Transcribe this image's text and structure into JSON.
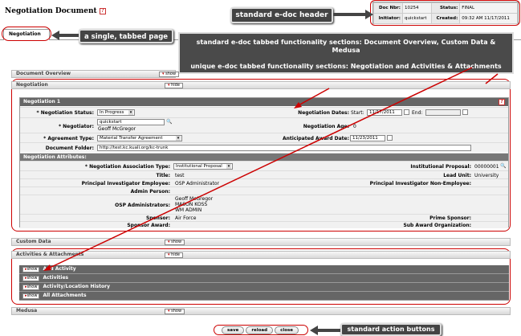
{
  "doc": {
    "title": "Negotiation Document"
  },
  "header": {
    "doc_nbr_label": "Doc Nbr:",
    "doc_nbr": "10254",
    "status_label": "Status:",
    "status": "FINAL",
    "initiator_label": "Initiator:",
    "initiator": "quickstart",
    "created_label": "Created:",
    "created": "09:32 AM 11/17/2011"
  },
  "tab": {
    "label": "Negotiation"
  },
  "callouts": {
    "header": "standard e-doc header",
    "tabbed": "a single, tabbed page",
    "sections_line1": "standard e-doc tabbed functionality sections:  Document Overview, Custom Data & Medusa",
    "sections_line2": "unique e-doc tabbed functionality sections:  Negotiation and Activities & Attachments",
    "actions": "standard action buttons"
  },
  "sections": {
    "overview": "Document Overview",
    "negotiation": "Negotiation",
    "custom": "Custom Data",
    "activities": "Activities & Attachments",
    "medusa": "Medusa",
    "show": "show",
    "hide": "hide"
  },
  "neg": {
    "panel_title": "Negotiation 1",
    "status_label": "* Negotiation Status:",
    "status": "In Progress",
    "dates_label": "Negotiation Dates:",
    "start_label": "Start:",
    "start": "11/17/2011",
    "end_label": "End:",
    "negotiator_label": "* Negotiator:",
    "negotiator_id": "quickstart",
    "negotiator_name": "Geoff McGregor",
    "age_label": "Negotiation Age:",
    "age": "0",
    "agreement_label": "* Agreement Type:",
    "agreement": "Material Transfer Agreement",
    "anticipated_label": "Anticipated Award Date:",
    "anticipated": "11/23/2011",
    "folder_label": "Document Folder:",
    "folder": "http://test.kc.kuali.org/kc-trunk"
  },
  "attrs": {
    "title": "Negotiation Attributes:",
    "assoc_label": "* Negotiation Association Type:",
    "assoc": "Institutional Proposal",
    "ip_label": "Institutional Proposal:",
    "ip": "00000001",
    "title_label": "Title:",
    "title_val": "test",
    "unit_label": "Lead Unit:",
    "unit": "University",
    "pi_label": "Principal Investigator Employee:",
    "pi": "OSP Administrator",
    "pine_label": "Principal Investigator Non-Employee:",
    "admin_label": "Admin Person:",
    "osp_label": "OSP Administrators:",
    "osp1": "Geoff McGregor",
    "osp2": "MASON KOSS",
    "osp3": "WM ADMIN",
    "sponsor_label": "Sponsor:",
    "sponsor": "Air Force",
    "prime_label": "Prime Sponsor:",
    "award_label": "Sponsor Award:",
    "sub_label": "Sub Award Organization:"
  },
  "activities": [
    {
      "label": "Add Activity"
    },
    {
      "label": "Activities"
    },
    {
      "label": "Activity/Location History"
    },
    {
      "label": "All Attachments"
    }
  ],
  "actions": {
    "save": "save",
    "reload": "reload",
    "close": "close"
  }
}
